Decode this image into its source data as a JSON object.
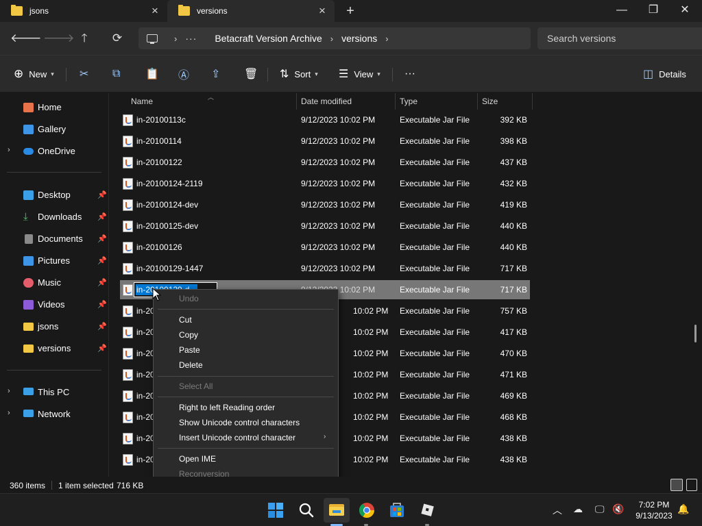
{
  "tabs": [
    {
      "label": "jsons",
      "active": false
    },
    {
      "label": "versions",
      "active": true
    }
  ],
  "window_controls": {
    "minimize": "—",
    "maximize": "❐",
    "close": "✕"
  },
  "address": {
    "more": "···",
    "crumbs": [
      "Betacraft Version Archive",
      "versions"
    ]
  },
  "search": {
    "placeholder": "Search versions"
  },
  "commands": {
    "new_label": "New",
    "sort_label": "Sort",
    "view_label": "View",
    "more": "···",
    "details_label": "Details"
  },
  "sidebar": {
    "items": [
      {
        "label": "Home",
        "icon": "home-icon",
        "color": "#e8734a"
      },
      {
        "label": "Gallery",
        "icon": "gallery-icon",
        "color": "#3e95e8"
      },
      {
        "label": "OneDrive",
        "icon": "cloud-icon",
        "color": "#2a8be6"
      },
      {
        "label": "Desktop",
        "icon": "desktop-icon",
        "color": "#3aa0e8"
      },
      {
        "label": "Downloads",
        "icon": "download-icon",
        "color": "#4fc36b"
      },
      {
        "label": "Documents",
        "icon": "document-icon",
        "color": "#8a8a8a"
      },
      {
        "label": "Pictures",
        "icon": "pictures-icon",
        "color": "#3e95e8"
      },
      {
        "label": "Music",
        "icon": "music-icon",
        "color": "#e35d6a"
      },
      {
        "label": "Videos",
        "icon": "videos-icon",
        "color": "#8e5bd8"
      },
      {
        "label": "jsons",
        "icon": "folder-icon",
        "color": "#f2c744"
      },
      {
        "label": "versions",
        "icon": "folder-icon",
        "color": "#f2c744"
      },
      {
        "label": "This PC",
        "icon": "computer-icon",
        "color": "#3aa0e8"
      },
      {
        "label": "Network",
        "icon": "network-icon",
        "color": "#3aa0e8"
      }
    ]
  },
  "columns": {
    "name": "Name",
    "date": "Date modified",
    "type": "Type",
    "size": "Size"
  },
  "files": [
    {
      "name": "in-20100113c",
      "date": "9/12/2023 10:02 PM",
      "type": "Executable Jar File",
      "size": "392 KB"
    },
    {
      "name": "in-20100114",
      "date": "9/12/2023 10:02 PM",
      "type": "Executable Jar File",
      "size": "398 KB"
    },
    {
      "name": "in-20100122",
      "date": "9/12/2023 10:02 PM",
      "type": "Executable Jar File",
      "size": "437 KB"
    },
    {
      "name": "in-20100124-2119",
      "date": "9/12/2023 10:02 PM",
      "type": "Executable Jar File",
      "size": "432 KB"
    },
    {
      "name": "in-20100124-dev",
      "date": "9/12/2023 10:02 PM",
      "type": "Executable Jar File",
      "size": "419 KB"
    },
    {
      "name": "in-20100125-dev",
      "date": "9/12/2023 10:02 PM",
      "type": "Executable Jar File",
      "size": "440 KB"
    },
    {
      "name": "in-20100126",
      "date": "9/12/2023 10:02 PM",
      "type": "Executable Jar File",
      "size": "440 KB"
    },
    {
      "name": "in-20100129-1447",
      "date": "9/12/2023 10:02 PM",
      "type": "Executable Jar File",
      "size": "717 KB"
    },
    {
      "name": "",
      "date": "9/12/2023 10:02 PM",
      "type": "Executable Jar File",
      "size": "717 KB"
    },
    {
      "name": "in-20",
      "date": "10:02 PM",
      "type": "Executable Jar File",
      "size": "757 KB"
    },
    {
      "name": "in-20",
      "date": "10:02 PM",
      "type": "Executable Jar File",
      "size": "417 KB"
    },
    {
      "name": "in-20",
      "date": "10:02 PM",
      "type": "Executable Jar File",
      "size": "470 KB"
    },
    {
      "name": "in-20",
      "date": "10:02 PM",
      "type": "Executable Jar File",
      "size": "471 KB"
    },
    {
      "name": "in-20",
      "date": "10:02 PM",
      "type": "Executable Jar File",
      "size": "469 KB"
    },
    {
      "name": "in-20",
      "date": "10:02 PM",
      "type": "Executable Jar File",
      "size": "468 KB"
    },
    {
      "name": "in-20",
      "date": "10:02 PM",
      "type": "Executable Jar File",
      "size": "438 KB"
    },
    {
      "name": "in-20",
      "date": "10:02 PM",
      "type": "Executable Jar File",
      "size": "438 KB"
    }
  ],
  "rename_field": {
    "selected_text": "in-20100129-d"
  },
  "context_menu": {
    "undo": "Undo",
    "cut": "Cut",
    "copy": "Copy",
    "paste": "Paste",
    "delete": "Delete",
    "select_all": "Select All",
    "rtl": "Right to left Reading order",
    "show_unicode": "Show Unicode control characters",
    "insert_unicode": "Insert Unicode control character",
    "open_ime": "Open IME",
    "reconversion": "Reconversion"
  },
  "status": {
    "items": "360 items",
    "selected": "1 item selected",
    "size": "716 KB"
  },
  "clock": {
    "time": "7:02 PM",
    "date": "9/13/2023"
  }
}
